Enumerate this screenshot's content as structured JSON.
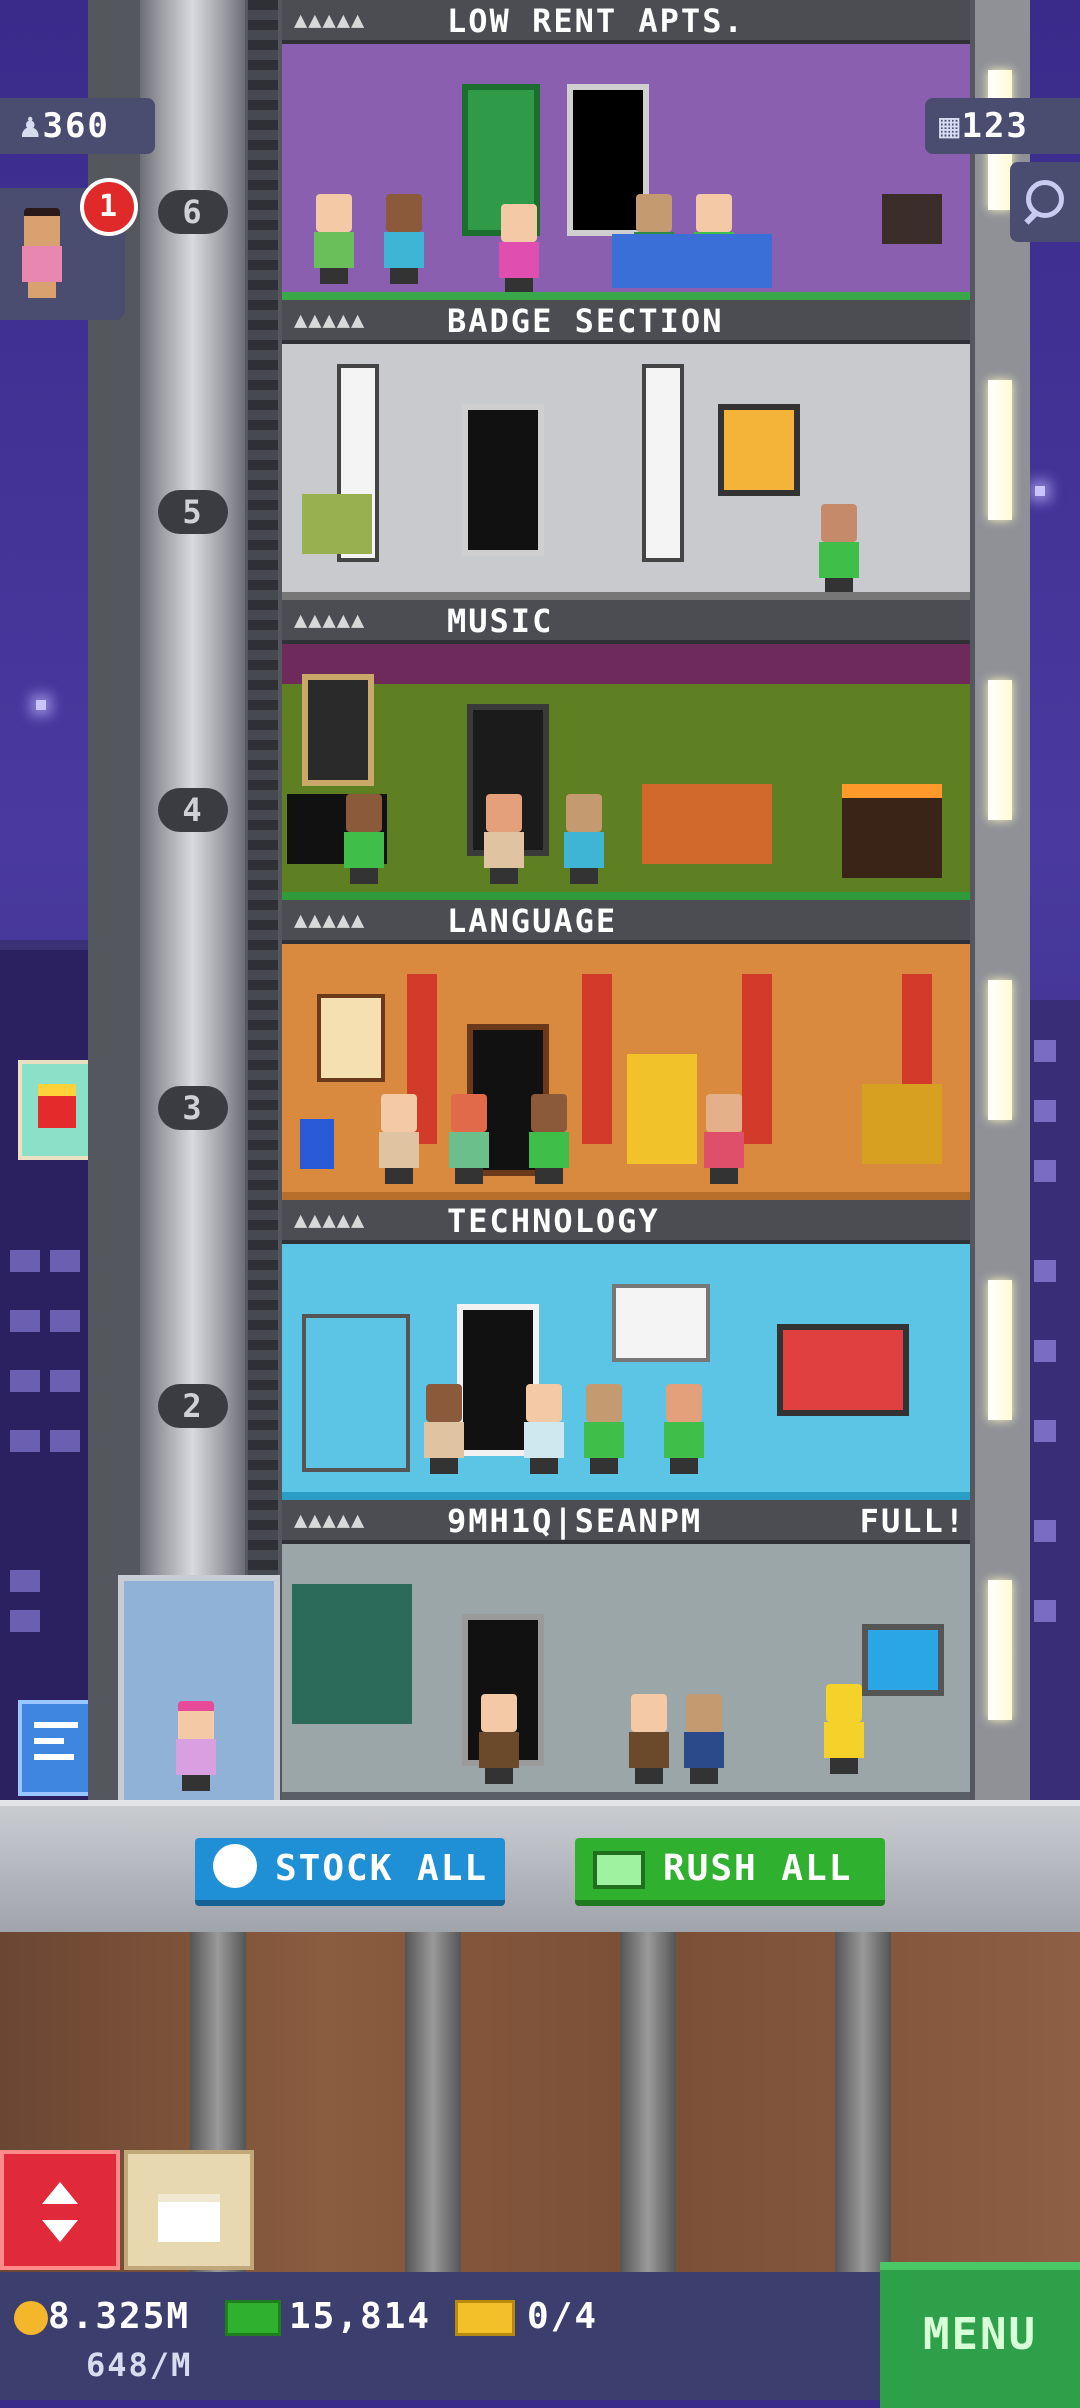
{
  "top_left_population": "360",
  "top_right_floors": "123",
  "notification_count": "1",
  "floors": [
    {
      "number": "6",
      "name": "LOW RENT APTS.",
      "status": "",
      "wall": "#8a5fb0",
      "ground": "#3aa84a"
    },
    {
      "number": "5",
      "name": "BADGE SECTION",
      "status": "",
      "wall": "#c9cacd",
      "ground": "#777777"
    },
    {
      "number": "4",
      "name": "MUSIC",
      "status": "",
      "wall": "#5e7f22",
      "ground": "#2f9b3a"
    },
    {
      "number": "3",
      "name": "LANGUAGE",
      "status": "",
      "wall": "#d98a3e",
      "ground": "#b86f2c"
    },
    {
      "number": "2",
      "name": "TECHNOLOGY",
      "status": "",
      "wall": "#5cc5e6",
      "ground": "#2b9dc4"
    },
    {
      "number": "",
      "name": "9MH1Q|SEANPM",
      "status": "FULL!",
      "wall": "#9aa6a8",
      "ground": "#5a5f66"
    }
  ],
  "buttons": {
    "stock_all": "STOCK ALL",
    "rush_all": "RUSH ALL",
    "menu": "MENU"
  },
  "hud": {
    "coins": "8.325M",
    "bux": "15,814",
    "tickets": "0/4",
    "rate": "648/M"
  },
  "colors": {
    "stock_button": "#1f8fd6",
    "rush_button": "#2fb02f",
    "menu_button": "#2fa04a",
    "elevator_button": "#e02a3a"
  },
  "icons": [
    "person-icon",
    "building-icon",
    "search-icon",
    "clock-icon",
    "cash-icon",
    "coin-icon",
    "ticket-icon",
    "elevator-arrows-icon",
    "box-icon",
    "fries-icon"
  ]
}
